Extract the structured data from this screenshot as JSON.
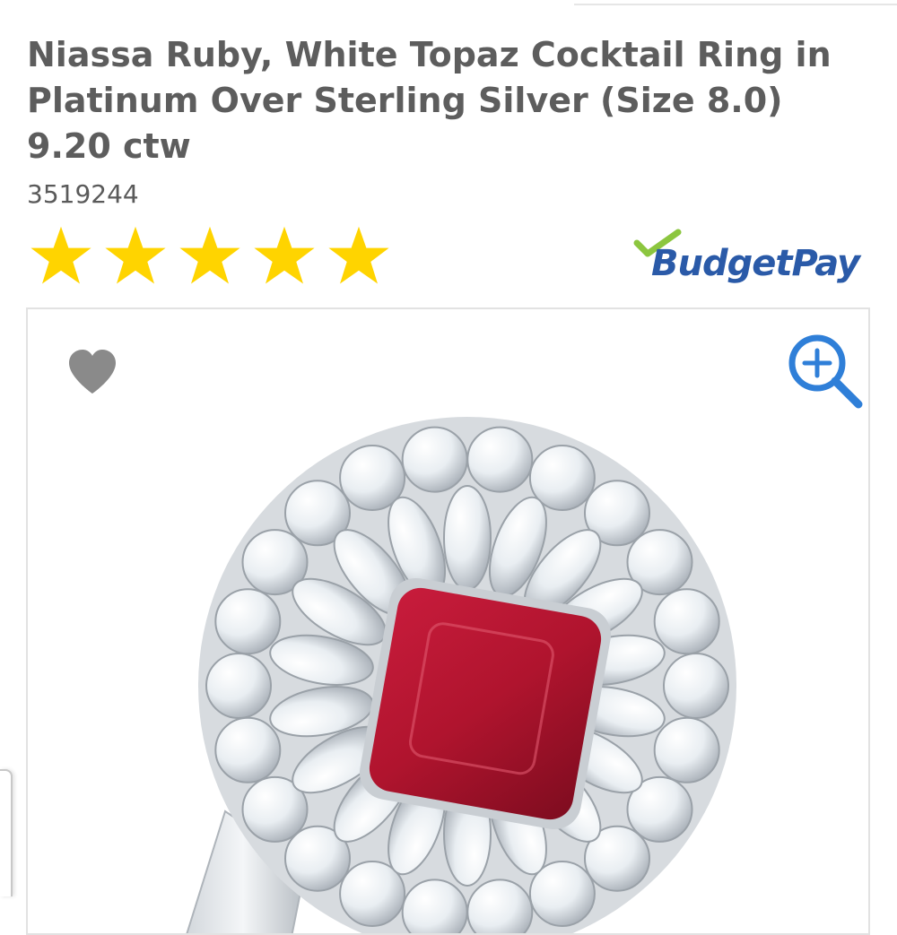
{
  "product": {
    "title": "Niassa Ruby, White Topaz Cocktail Ring in Platinum Over Sterling Silver (Size 8.0) 9.20 ctw",
    "sku": "3519244",
    "rating_stars": 5,
    "rating_max": 5
  },
  "budget_pay": {
    "label": "BudgetPay",
    "logo_color": "#2a5aa8",
    "check_color": "#8cc63f"
  },
  "gallery": {
    "favorite_icon": "heart-icon",
    "zoom_icon": "zoom-in-icon",
    "image_alt": "ring-image"
  },
  "colors": {
    "star": "#ffd400",
    "title": "#5d5d5d",
    "zoom": "#2f7fd8",
    "heart": "#8a8a8a",
    "ruby": "#b0142e"
  }
}
